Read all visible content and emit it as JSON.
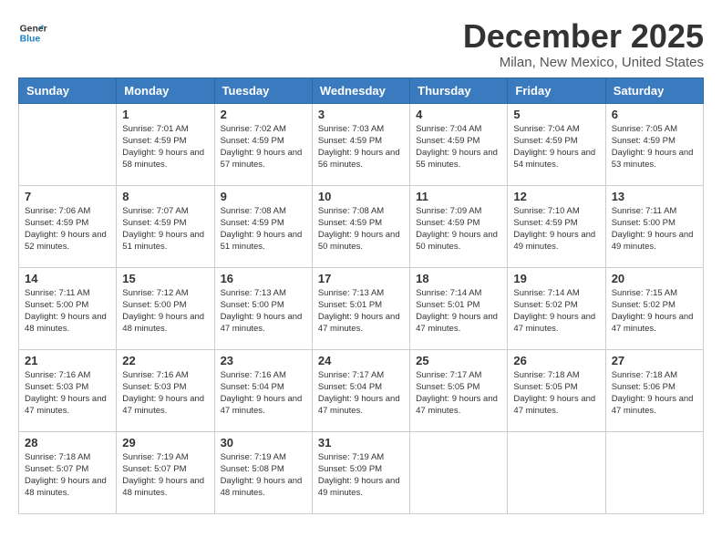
{
  "logo": {
    "line1": "General",
    "line2": "Blue"
  },
  "title": "December 2025",
  "subtitle": "Milan, New Mexico, United States",
  "headers": [
    "Sunday",
    "Monday",
    "Tuesday",
    "Wednesday",
    "Thursday",
    "Friday",
    "Saturday"
  ],
  "weeks": [
    [
      {
        "day": "",
        "sunrise": "",
        "sunset": "",
        "daylight": ""
      },
      {
        "day": "1",
        "sunrise": "Sunrise: 7:01 AM",
        "sunset": "Sunset: 4:59 PM",
        "daylight": "Daylight: 9 hours and 58 minutes."
      },
      {
        "day": "2",
        "sunrise": "Sunrise: 7:02 AM",
        "sunset": "Sunset: 4:59 PM",
        "daylight": "Daylight: 9 hours and 57 minutes."
      },
      {
        "day": "3",
        "sunrise": "Sunrise: 7:03 AM",
        "sunset": "Sunset: 4:59 PM",
        "daylight": "Daylight: 9 hours and 56 minutes."
      },
      {
        "day": "4",
        "sunrise": "Sunrise: 7:04 AM",
        "sunset": "Sunset: 4:59 PM",
        "daylight": "Daylight: 9 hours and 55 minutes."
      },
      {
        "day": "5",
        "sunrise": "Sunrise: 7:04 AM",
        "sunset": "Sunset: 4:59 PM",
        "daylight": "Daylight: 9 hours and 54 minutes."
      },
      {
        "day": "6",
        "sunrise": "Sunrise: 7:05 AM",
        "sunset": "Sunset: 4:59 PM",
        "daylight": "Daylight: 9 hours and 53 minutes."
      }
    ],
    [
      {
        "day": "7",
        "sunrise": "Sunrise: 7:06 AM",
        "sunset": "Sunset: 4:59 PM",
        "daylight": "Daylight: 9 hours and 52 minutes."
      },
      {
        "day": "8",
        "sunrise": "Sunrise: 7:07 AM",
        "sunset": "Sunset: 4:59 PM",
        "daylight": "Daylight: 9 hours and 51 minutes."
      },
      {
        "day": "9",
        "sunrise": "Sunrise: 7:08 AM",
        "sunset": "Sunset: 4:59 PM",
        "daylight": "Daylight: 9 hours and 51 minutes."
      },
      {
        "day": "10",
        "sunrise": "Sunrise: 7:08 AM",
        "sunset": "Sunset: 4:59 PM",
        "daylight": "Daylight: 9 hours and 50 minutes."
      },
      {
        "day": "11",
        "sunrise": "Sunrise: 7:09 AM",
        "sunset": "Sunset: 4:59 PM",
        "daylight": "Daylight: 9 hours and 50 minutes."
      },
      {
        "day": "12",
        "sunrise": "Sunrise: 7:10 AM",
        "sunset": "Sunset: 4:59 PM",
        "daylight": "Daylight: 9 hours and 49 minutes."
      },
      {
        "day": "13",
        "sunrise": "Sunrise: 7:11 AM",
        "sunset": "Sunset: 5:00 PM",
        "daylight": "Daylight: 9 hours and 49 minutes."
      }
    ],
    [
      {
        "day": "14",
        "sunrise": "Sunrise: 7:11 AM",
        "sunset": "Sunset: 5:00 PM",
        "daylight": "Daylight: 9 hours and 48 minutes."
      },
      {
        "day": "15",
        "sunrise": "Sunrise: 7:12 AM",
        "sunset": "Sunset: 5:00 PM",
        "daylight": "Daylight: 9 hours and 48 minutes."
      },
      {
        "day": "16",
        "sunrise": "Sunrise: 7:13 AM",
        "sunset": "Sunset: 5:00 PM",
        "daylight": "Daylight: 9 hours and 47 minutes."
      },
      {
        "day": "17",
        "sunrise": "Sunrise: 7:13 AM",
        "sunset": "Sunset: 5:01 PM",
        "daylight": "Daylight: 9 hours and 47 minutes."
      },
      {
        "day": "18",
        "sunrise": "Sunrise: 7:14 AM",
        "sunset": "Sunset: 5:01 PM",
        "daylight": "Daylight: 9 hours and 47 minutes."
      },
      {
        "day": "19",
        "sunrise": "Sunrise: 7:14 AM",
        "sunset": "Sunset: 5:02 PM",
        "daylight": "Daylight: 9 hours and 47 minutes."
      },
      {
        "day": "20",
        "sunrise": "Sunrise: 7:15 AM",
        "sunset": "Sunset: 5:02 PM",
        "daylight": "Daylight: 9 hours and 47 minutes."
      }
    ],
    [
      {
        "day": "21",
        "sunrise": "Sunrise: 7:16 AM",
        "sunset": "Sunset: 5:03 PM",
        "daylight": "Daylight: 9 hours and 47 minutes."
      },
      {
        "day": "22",
        "sunrise": "Sunrise: 7:16 AM",
        "sunset": "Sunset: 5:03 PM",
        "daylight": "Daylight: 9 hours and 47 minutes."
      },
      {
        "day": "23",
        "sunrise": "Sunrise: 7:16 AM",
        "sunset": "Sunset: 5:04 PM",
        "daylight": "Daylight: 9 hours and 47 minutes."
      },
      {
        "day": "24",
        "sunrise": "Sunrise: 7:17 AM",
        "sunset": "Sunset: 5:04 PM",
        "daylight": "Daylight: 9 hours and 47 minutes."
      },
      {
        "day": "25",
        "sunrise": "Sunrise: 7:17 AM",
        "sunset": "Sunset: 5:05 PM",
        "daylight": "Daylight: 9 hours and 47 minutes."
      },
      {
        "day": "26",
        "sunrise": "Sunrise: 7:18 AM",
        "sunset": "Sunset: 5:05 PM",
        "daylight": "Daylight: 9 hours and 47 minutes."
      },
      {
        "day": "27",
        "sunrise": "Sunrise: 7:18 AM",
        "sunset": "Sunset: 5:06 PM",
        "daylight": "Daylight: 9 hours and 47 minutes."
      }
    ],
    [
      {
        "day": "28",
        "sunrise": "Sunrise: 7:18 AM",
        "sunset": "Sunset: 5:07 PM",
        "daylight": "Daylight: 9 hours and 48 minutes."
      },
      {
        "day": "29",
        "sunrise": "Sunrise: 7:19 AM",
        "sunset": "Sunset: 5:07 PM",
        "daylight": "Daylight: 9 hours and 48 minutes."
      },
      {
        "day": "30",
        "sunrise": "Sunrise: 7:19 AM",
        "sunset": "Sunset: 5:08 PM",
        "daylight": "Daylight: 9 hours and 48 minutes."
      },
      {
        "day": "31",
        "sunrise": "Sunrise: 7:19 AM",
        "sunset": "Sunset: 5:09 PM",
        "daylight": "Daylight: 9 hours and 49 minutes."
      },
      {
        "day": "",
        "sunrise": "",
        "sunset": "",
        "daylight": ""
      },
      {
        "day": "",
        "sunrise": "",
        "sunset": "",
        "daylight": ""
      },
      {
        "day": "",
        "sunrise": "",
        "sunset": "",
        "daylight": ""
      }
    ]
  ]
}
